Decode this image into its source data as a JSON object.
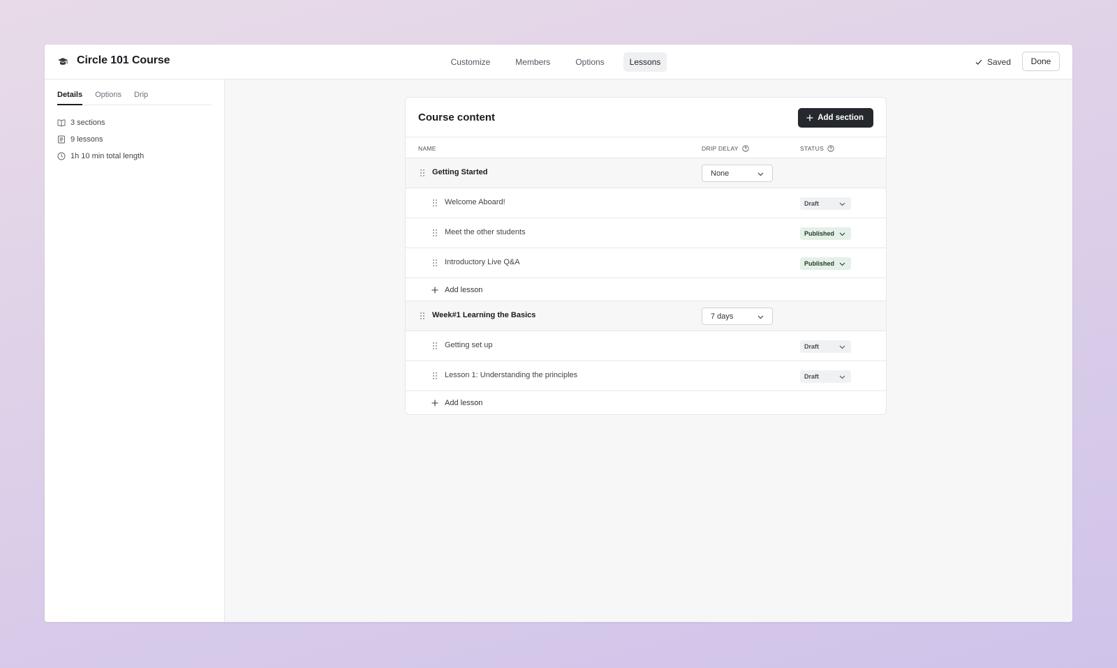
{
  "header": {
    "title": "Circle 101 Course",
    "logo_icon": "graduation-cap-icon",
    "tabs": [
      {
        "label": "Customize",
        "active": false
      },
      {
        "label": "Members",
        "active": false
      },
      {
        "label": "Options",
        "active": false
      },
      {
        "label": "Lessons",
        "active": true
      }
    ],
    "saved_label": "Saved",
    "done_label": "Done"
  },
  "sidebar": {
    "tabs": [
      {
        "label": "Details",
        "active": true
      },
      {
        "label": "Options",
        "active": false
      },
      {
        "label": "Drip",
        "active": false
      }
    ],
    "stats": [
      {
        "icon": "book-icon",
        "label": "3 sections"
      },
      {
        "icon": "document-icon",
        "label": "9 lessons"
      },
      {
        "icon": "clock-icon",
        "label": "1h 10 min total length"
      }
    ]
  },
  "content": {
    "title": "Course content",
    "add_section_label": "Add section",
    "columns": {
      "name": "NAME",
      "drip_delay": "DRIP DELAY",
      "status": "STATUS"
    },
    "add_lesson_label": "Add lesson",
    "sections": [
      {
        "name": "Getting Started",
        "drip_delay": "None",
        "lessons": [
          {
            "name": "Welcome Aboard!",
            "status": "Draft"
          },
          {
            "name": "Meet the other students",
            "status": "Published"
          },
          {
            "name": "Introductory Live Q&A",
            "status": "Published"
          }
        ]
      },
      {
        "name": "Week#1 Learning the Basics",
        "drip_delay": "7 days",
        "lessons": [
          {
            "name": "Getting set up",
            "status": "Draft"
          },
          {
            "name": "Lesson 1: Understanding the principles",
            "status": "Draft"
          }
        ]
      }
    ]
  },
  "colors": {
    "primary_button": "#25282d",
    "published_bg": "#e4f0e8",
    "draft_bg": "#f0f1f3"
  }
}
